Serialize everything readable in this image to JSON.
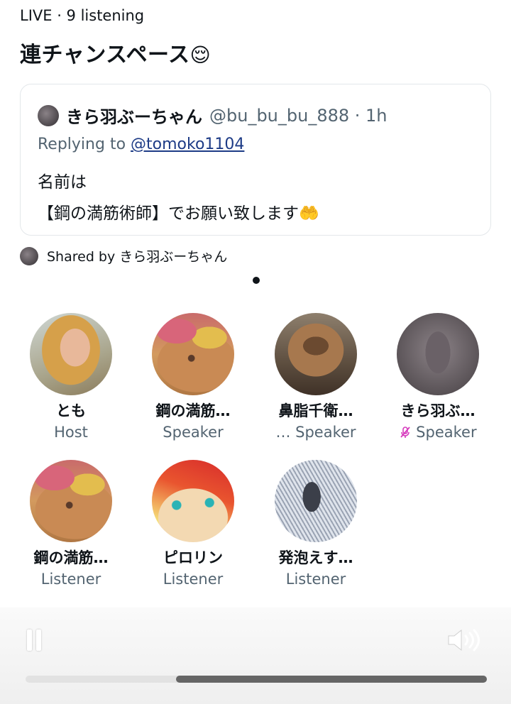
{
  "status_line": "LIVE · 9 listening",
  "space_title": "連チャンスペース",
  "space_title_emoji": "😌",
  "tweet": {
    "author": "きら羽ぶーちゃん",
    "handle_time": "@bu_bu_bu_888 · 1h",
    "replying_prefix": "Replying to ",
    "replying_handle": "@tomoko1104",
    "body_line1": "名前は",
    "body_line2": "【鋼の満筋術師】でお願い致します🤲"
  },
  "shared_by": "Shared by きら羽ぶーちゃん",
  "participants": [
    {
      "name": "とも",
      "role": "Host",
      "avatar": "woman-photo-avatar"
    },
    {
      "name": "鋼の満筋…",
      "role": "Speaker",
      "avatar": "cartoon-avatar"
    },
    {
      "name": "鼻脂千衛…",
      "role": "… Speaker",
      "avatar": "alf-avatar"
    },
    {
      "name": "きら羽ぶ…",
      "role": "Speaker",
      "avatar": "blurred-avatar",
      "muted": true
    },
    {
      "name": "鋼の満筋…",
      "role": "Listener",
      "avatar": "cartoon-avatar"
    },
    {
      "name": "ピロリン",
      "role": "Listener",
      "avatar": "anime-face-avatar"
    },
    {
      "name": "発泡えす…",
      "role": "Listener",
      "avatar": "sketch-avatar"
    }
  ],
  "icons": {
    "pause": "pause-icon",
    "volume": "speaker-volume-icon",
    "mic_off": "mic-off-icon"
  },
  "playback_progress": 0.33,
  "colors": {
    "link": "#1d3b86",
    "muted_mic": "#d63bbd",
    "progress_fill": "#666666"
  }
}
